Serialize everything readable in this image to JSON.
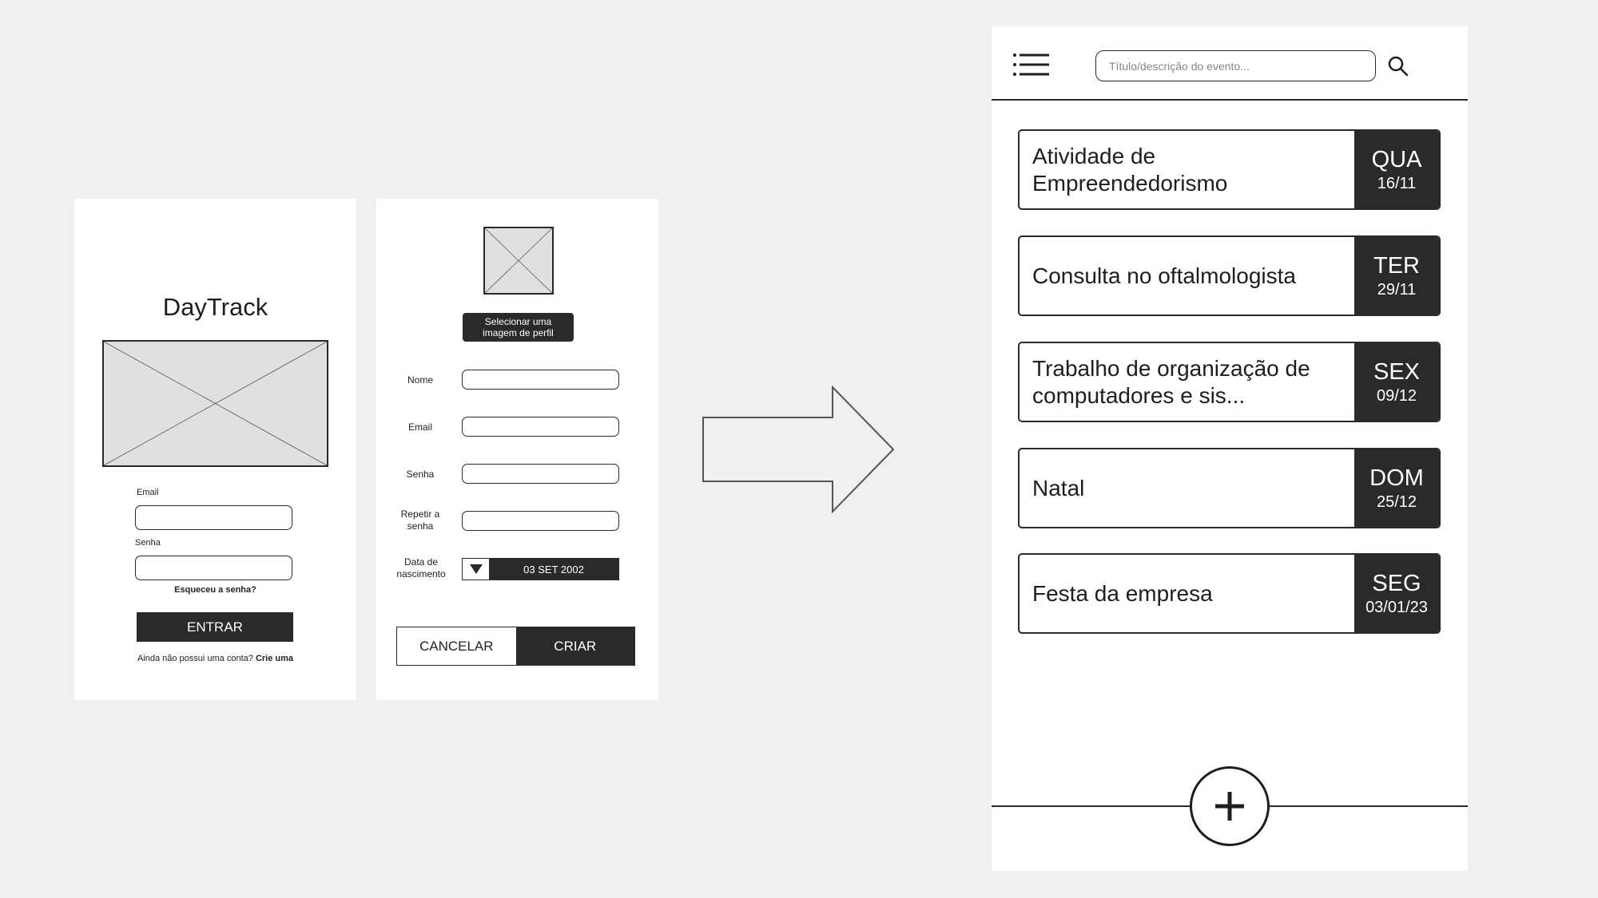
{
  "login": {
    "app_title": "DayTrack",
    "email_label": "Email",
    "password_label": "Senha",
    "forgot_password": "Esqueceu a senha?",
    "enter_button": "ENTRAR",
    "signup_prompt": "Ainda não possui uma conta?",
    "signup_link": "Crie uma"
  },
  "register": {
    "select_image_button": "Selecionar uma imagem de perfil",
    "name_label": "Nome",
    "email_label": "Email",
    "password_label": "Senha",
    "repeat_password_label": "Repetir a senha",
    "birthdate_label": "Data de nascimento",
    "birthdate_value": "03 SET 2002",
    "cancel_button": "CANCELAR",
    "create_button": "CRIAR"
  },
  "events": {
    "search_placeholder": "Título/descrição do evento...",
    "items": [
      {
        "title": "Atividade de Empreendedorismo",
        "day": "QUA",
        "date": "16/11"
      },
      {
        "title": "Consulta no oftalmologista",
        "day": "TER",
        "date": "29/11"
      },
      {
        "title": "Trabalho de organização de computadores e sis...",
        "day": "SEX",
        "date": "09/12"
      },
      {
        "title": "Natal",
        "day": "DOM",
        "date": "25/12"
      },
      {
        "title": "Festa da empresa",
        "day": "SEG",
        "date": "03/01/23"
      }
    ]
  },
  "icons": {
    "menu": "menu-icon",
    "search": "search-icon",
    "add": "plus-icon",
    "dropdown": "dropdown-arrow-icon",
    "arrow": "right-arrow-icon"
  },
  "colors": {
    "background": "#f0f0f0",
    "frame": "#ffffff",
    "dark": "#2a2a2a",
    "placeholder_fill": "#e0e0e0"
  }
}
